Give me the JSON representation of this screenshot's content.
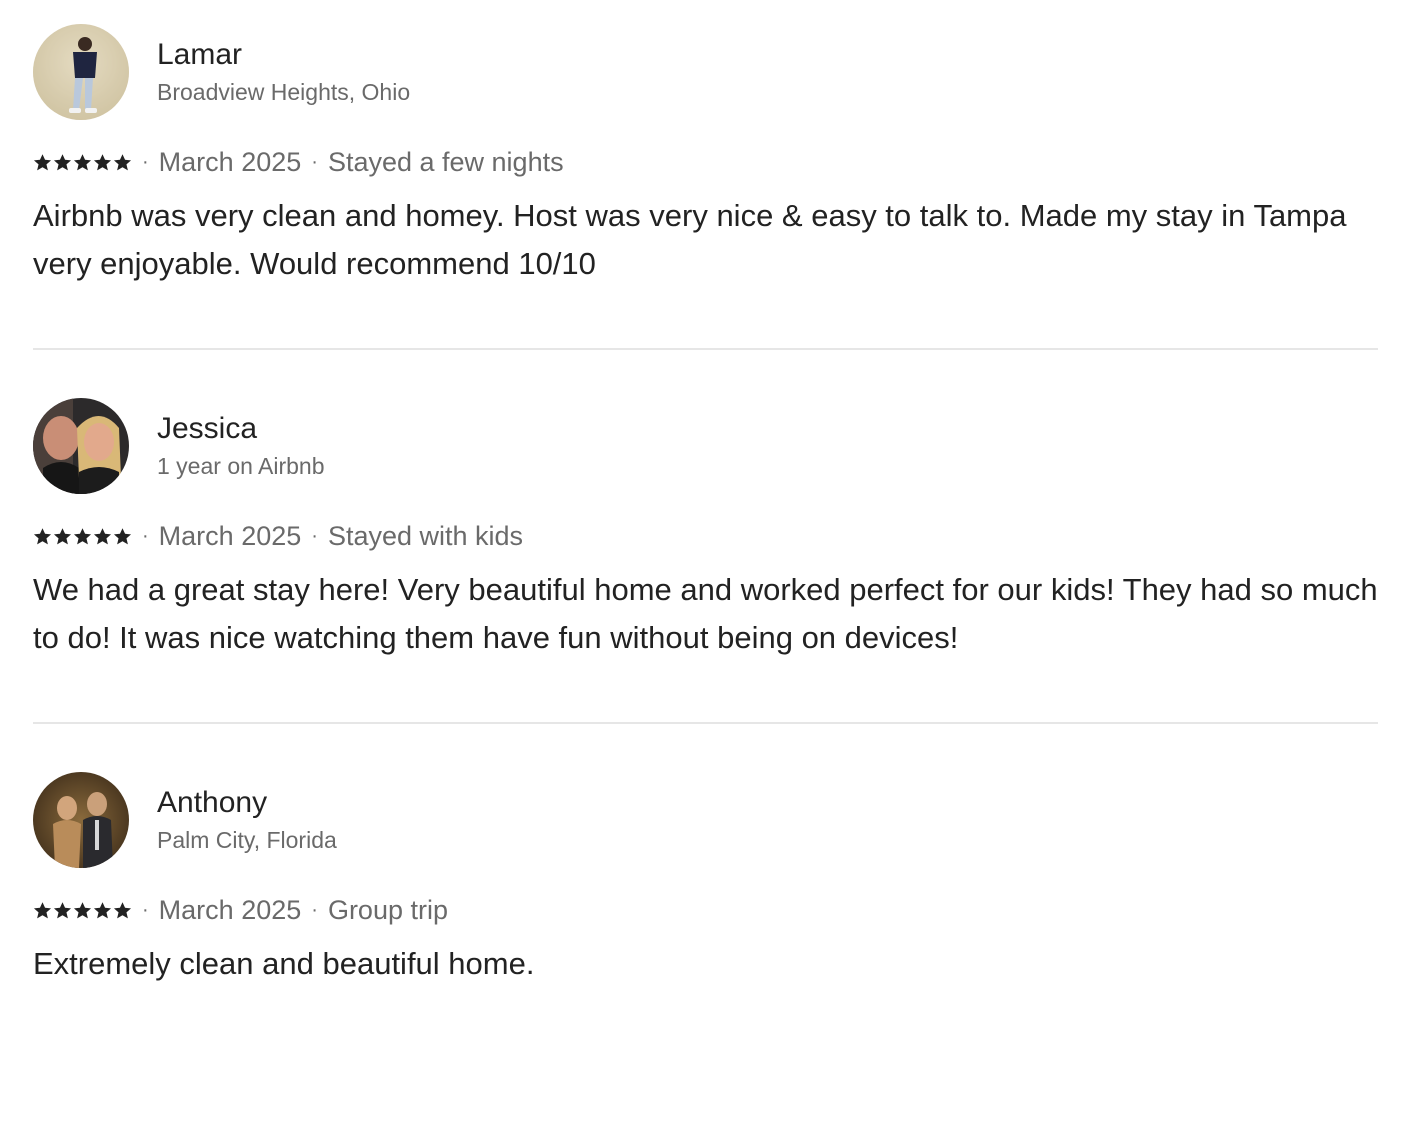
{
  "reviews": [
    {
      "name": "Lamar",
      "subtitle": "Broadview Heights, Ohio",
      "rating": 5,
      "date": "March 2025",
      "trip": "Stayed a few nights",
      "text": "Airbnb was very clean and homey. Host was very nice & easy to talk to. Made my stay in Tampa very enjoyable. Would recommend 10/10"
    },
    {
      "name": "Jessica",
      "subtitle": "1 year on Airbnb",
      "rating": 5,
      "date": "March 2025",
      "trip": "Stayed with kids",
      "text": "We had a great stay here! Very beautiful home and worked perfect for our kids! They had so much to do! It was nice watching them have fun without being on devices!"
    },
    {
      "name": "Anthony",
      "subtitle": "Palm City, Florida",
      "rating": 5,
      "date": "March 2025",
      "trip": "Group trip",
      "text": "Extremely clean and beautiful home."
    }
  ],
  "separator": "·",
  "icons": {
    "star": "star-icon",
    "avatar": "avatar"
  },
  "colors": {
    "text_primary": "#222222",
    "text_secondary": "#6a6a6a",
    "divider": "#e6e6e6"
  }
}
